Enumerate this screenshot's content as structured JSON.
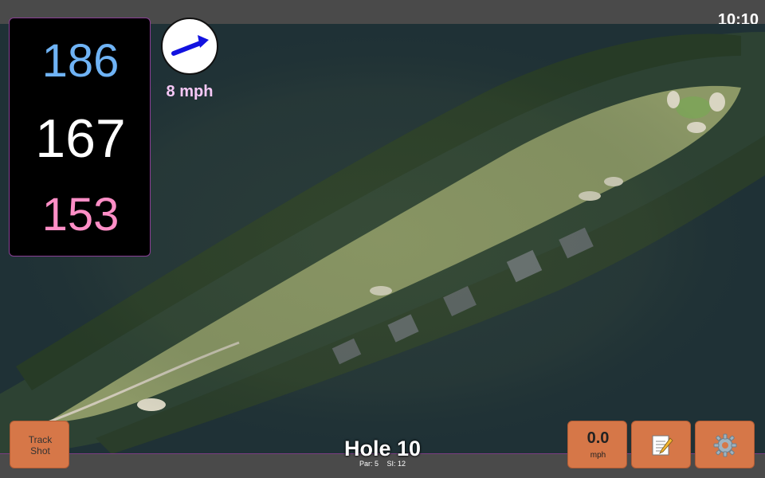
{
  "status": {
    "time": "10:10"
  },
  "distances": {
    "back": "186",
    "middle": "167",
    "front": "153"
  },
  "wind": {
    "speed": "8 mph",
    "arrow_icon": "wind-direction-arrow"
  },
  "hole": {
    "title": "Hole 10",
    "par_label": "Par: 5",
    "si_label": "SI: 12"
  },
  "buttons": {
    "track_shot_line1": "Track",
    "track_shot_line2": "Shot",
    "speed_value": "0.0",
    "speed_unit": "mph",
    "notes_icon": "notepad-icon",
    "settings_icon": "gear-icon"
  },
  "colors": {
    "back_distance": "#6fb3f5",
    "middle_distance": "#ffffff",
    "front_distance": "#ff8ec6",
    "button_bg": "#d67748",
    "accent_border": "#8a3e95"
  }
}
